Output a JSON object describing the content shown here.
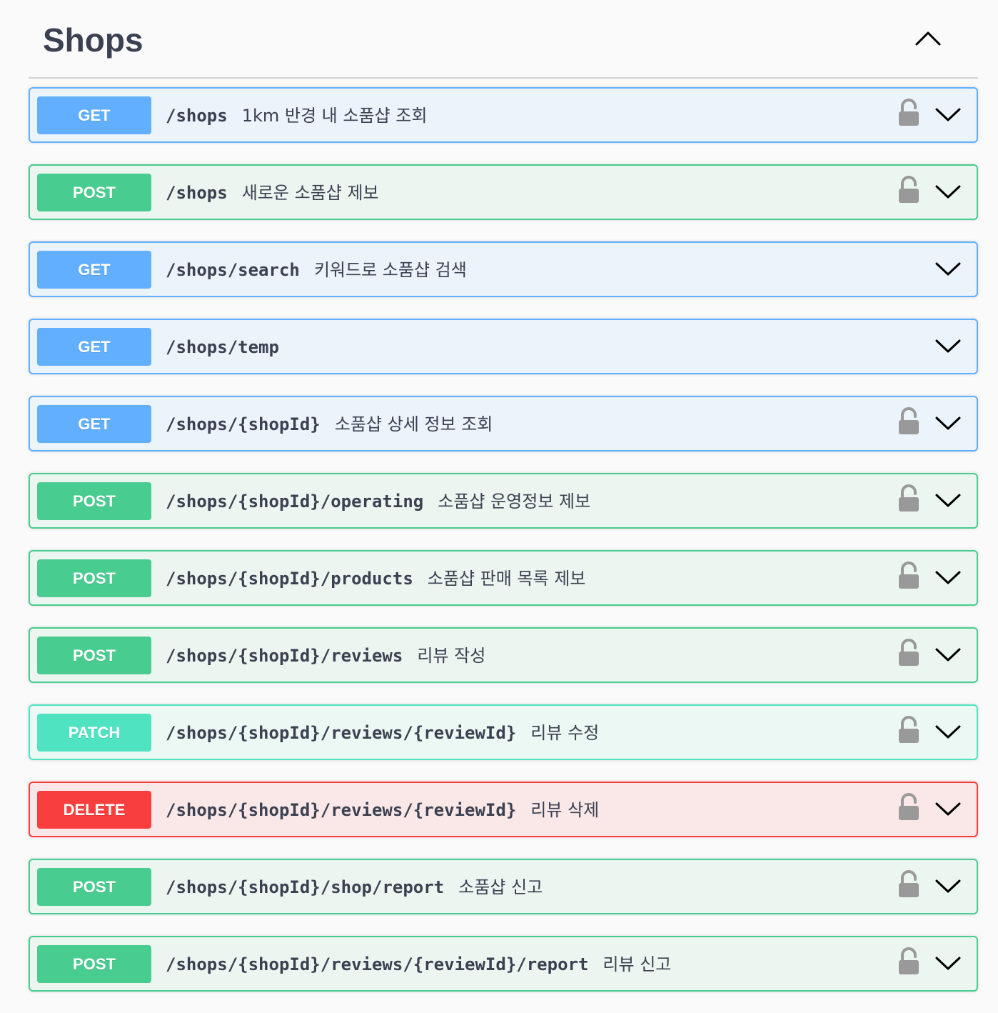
{
  "section": {
    "title": "Shops",
    "icon": "chevron-up-icon"
  },
  "colors": {
    "get": "#61affe",
    "post": "#49cc90",
    "patch": "#50e3c2",
    "delete": "#f93e3e"
  },
  "operations": [
    {
      "method": "GET",
      "path": "/shops",
      "summary": "1km 반경 내 소품샵 조회",
      "lock": true
    },
    {
      "method": "POST",
      "path": "/shops",
      "summary": "새로운 소품샵 제보",
      "lock": true
    },
    {
      "method": "GET",
      "path": "/shops/search",
      "summary": "키워드로 소품샵 검색",
      "lock": false
    },
    {
      "method": "GET",
      "path": "/shops/temp",
      "summary": "",
      "lock": false
    },
    {
      "method": "GET",
      "path": "/shops/{shopId}",
      "summary": "소품샵 상세 정보 조회",
      "lock": true
    },
    {
      "method": "POST",
      "path": "/shops/{shopId}/operating",
      "summary": "소품샵 운영정보 제보",
      "lock": true
    },
    {
      "method": "POST",
      "path": "/shops/{shopId}/products",
      "summary": "소품샵 판매 목록 제보",
      "lock": true
    },
    {
      "method": "POST",
      "path": "/shops/{shopId}/reviews",
      "summary": "리뷰 작성",
      "lock": true
    },
    {
      "method": "PATCH",
      "path": "/shops/{shopId}/reviews/{reviewId}",
      "summary": "리뷰 수정",
      "lock": true
    },
    {
      "method": "DELETE",
      "path": "/shops/{shopId}/reviews/{reviewId}",
      "summary": "리뷰 삭제",
      "lock": true
    },
    {
      "method": "POST",
      "path": "/shops/{shopId}/shop/report",
      "summary": "소품샵 신고",
      "lock": true
    },
    {
      "method": "POST",
      "path": "/shops/{shopId}/reviews/{reviewId}/report",
      "summary": "리뷰 신고",
      "lock": true
    }
  ]
}
